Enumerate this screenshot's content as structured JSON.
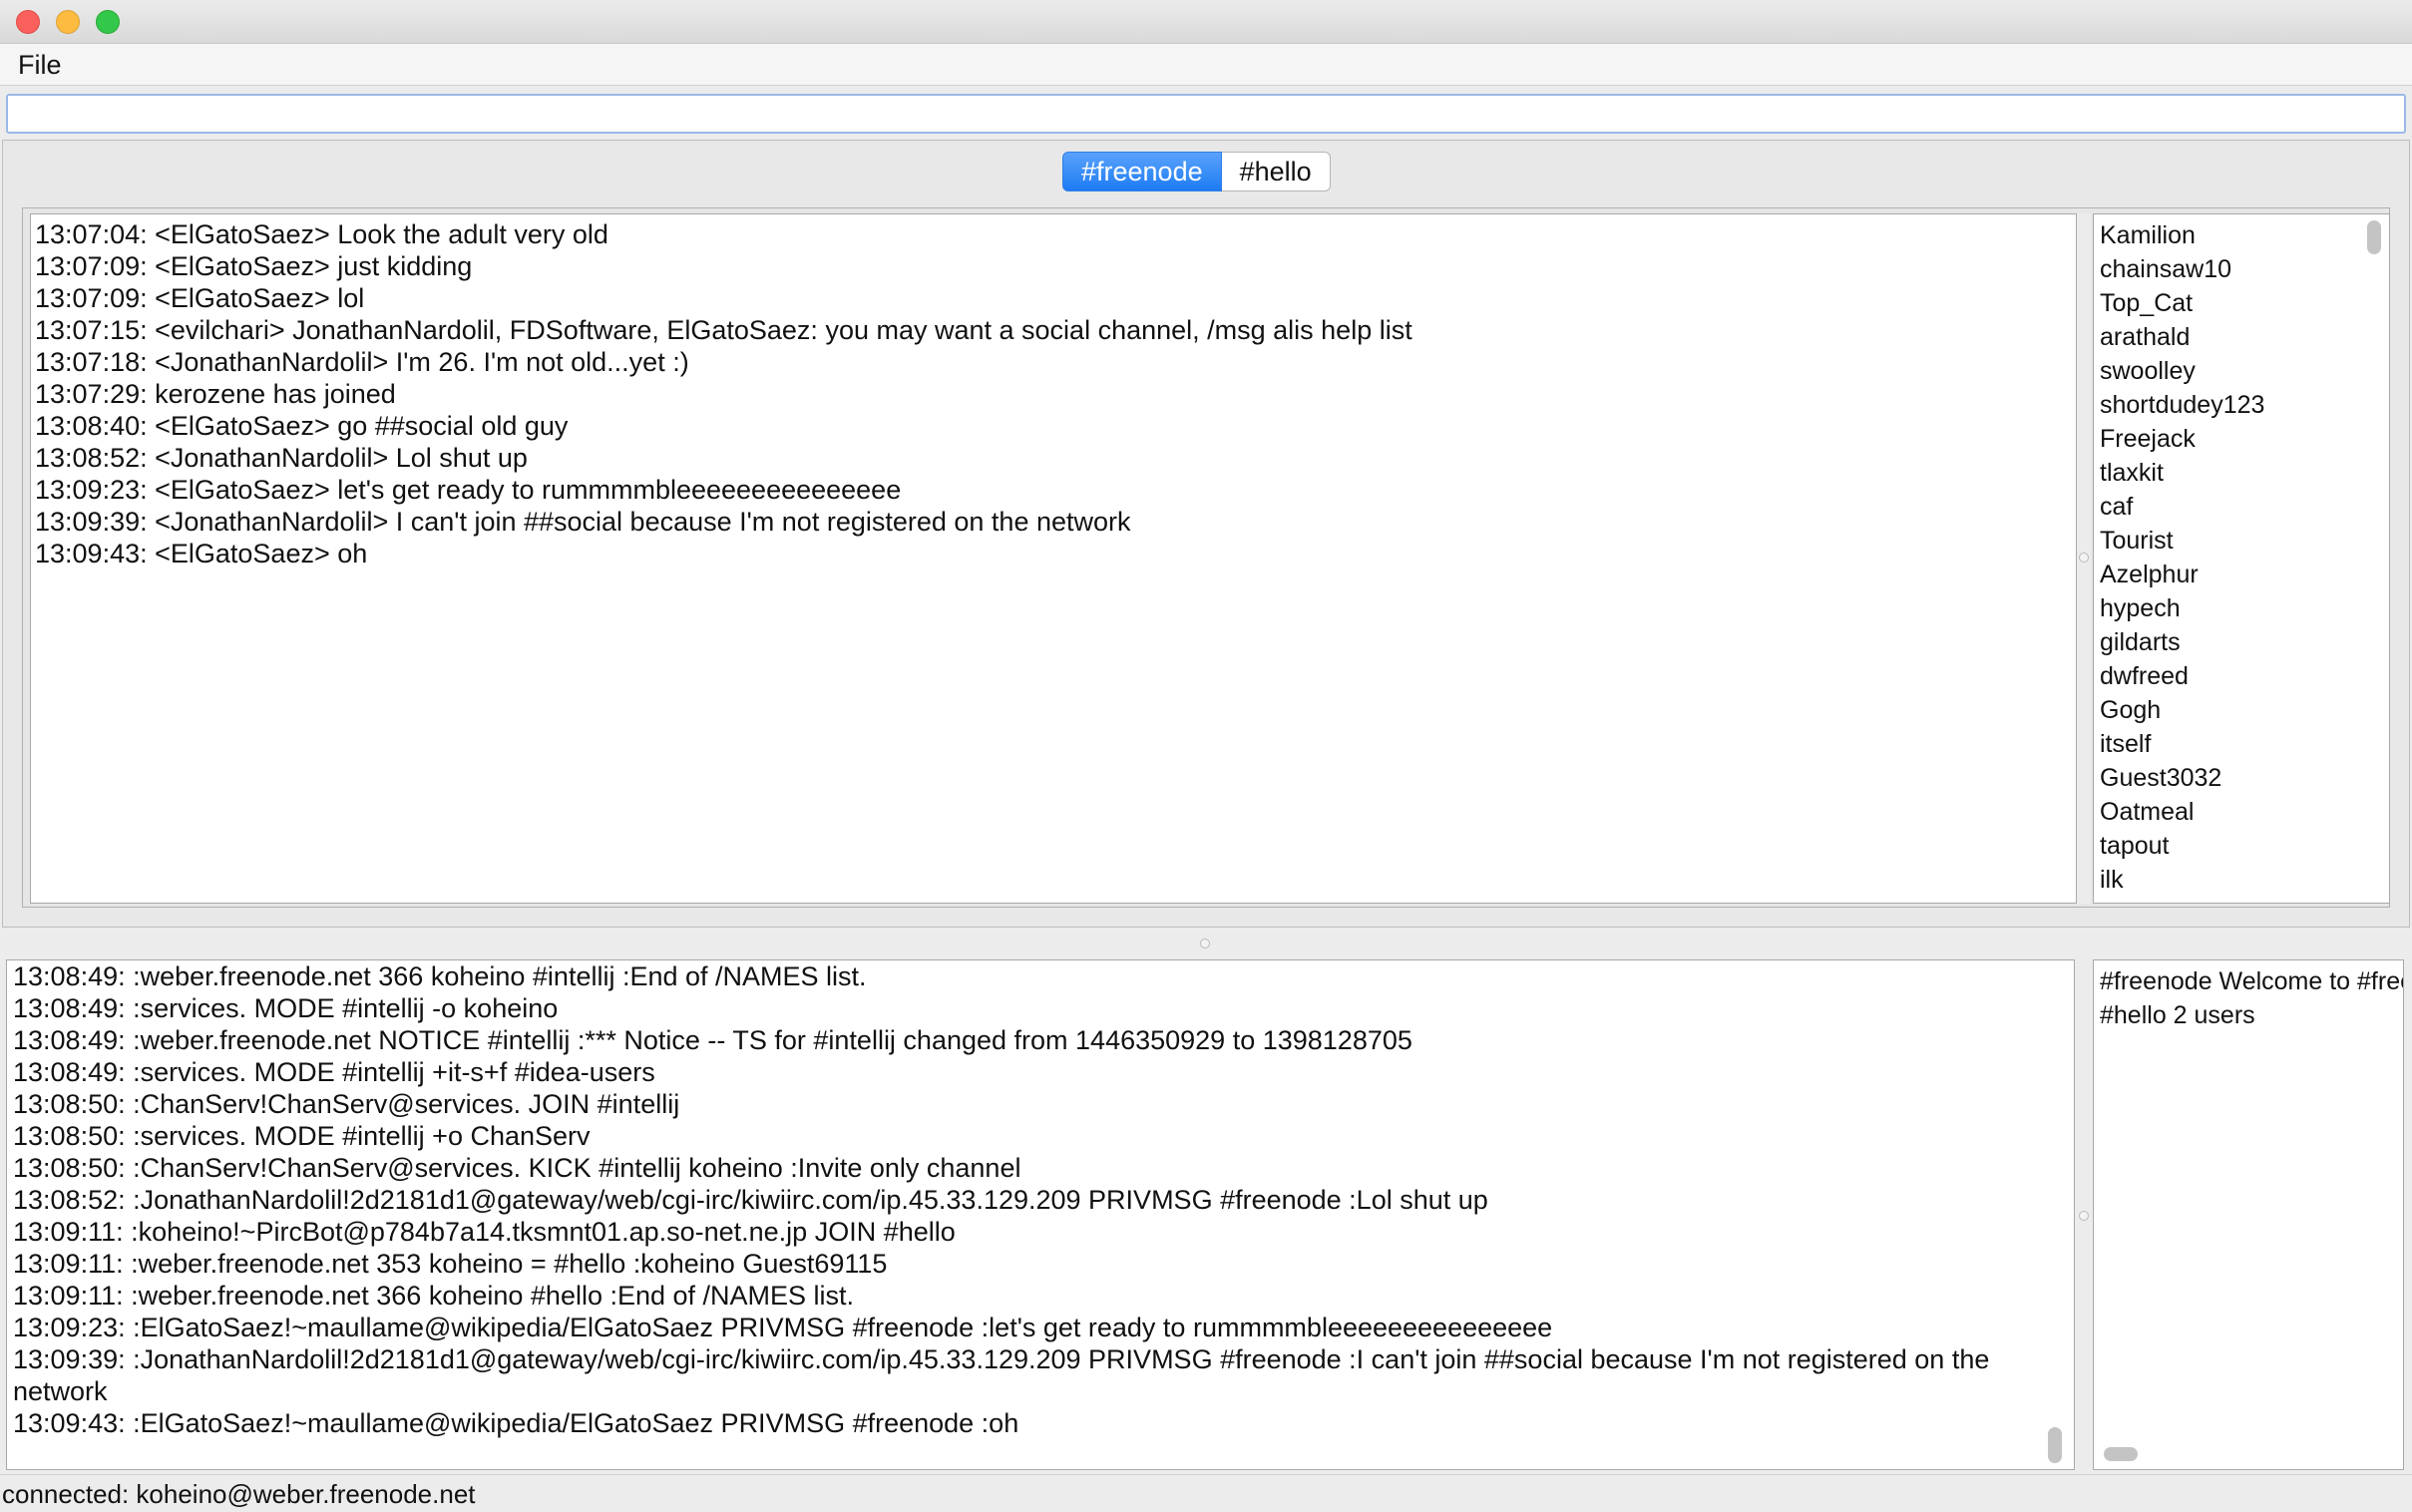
{
  "menu": {
    "file_label": "File"
  },
  "command_input": {
    "value": "",
    "placeholder": ""
  },
  "tabs": [
    {
      "label": "#freenode",
      "active": true
    },
    {
      "label": "#hello",
      "active": false
    }
  ],
  "chat": [
    "13:07:04: <ElGatoSaez> Look the adult very old",
    "13:07:09: <ElGatoSaez> just kidding",
    "13:07:09: <ElGatoSaez> lol",
    "13:07:15: <evilchari> JonathanNardolil, FDSoftware, ElGatoSaez: you may want a social channel, /msg alis help list",
    "13:07:18: <JonathanNardolil> I'm 26. I'm not old...yet :)",
    "13:07:29: kerozene has joined",
    "13:08:40: <ElGatoSaez> go ##social old guy",
    "13:08:52: <JonathanNardolil> Lol shut up",
    "13:09:23: <ElGatoSaez> let's get ready to rummmmbleeeeeeeeeeeeeee",
    "13:09:39: <JonathanNardolil> I can't join ##social because I'm not registered on the network",
    "13:09:43: <ElGatoSaez> oh"
  ],
  "users": [
    "Kamilion",
    "chainsaw10",
    "Top_Cat",
    "arathald",
    "swoolley",
    "shortdudey123",
    "Freejack",
    "tlaxkit",
    "caf",
    "Tourist",
    "Azelphur",
    "hypech",
    "gildarts",
    "dwfreed",
    "Gogh",
    "itself",
    "Guest3032",
    "Oatmeal",
    "tapout",
    "ilk"
  ],
  "log": [
    "13:08:49: :weber.freenode.net 366 koheino #intellij :End of /NAMES list.",
    "13:08:49: :services. MODE #intellij -o koheino",
    "13:08:49: :weber.freenode.net NOTICE #intellij :*** Notice -- TS for #intellij changed from 1446350929 to 1398128705",
    "13:08:49: :services. MODE #intellij +it-s+f #idea-users",
    "13:08:50: :ChanServ!ChanServ@services. JOIN #intellij",
    "13:08:50: :services. MODE #intellij +o ChanServ",
    "13:08:50: :ChanServ!ChanServ@services. KICK #intellij koheino :Invite only channel",
    "13:08:52: :JonathanNardolil!2d2181d1@gateway/web/cgi-irc/kiwiirc.com/ip.45.33.129.209 PRIVMSG #freenode :Lol shut up",
    "13:09:11: :koheino!~PircBot@p784b7a14.tksmnt01.ap.so-net.ne.jp JOIN #hello",
    "13:09:11: :weber.freenode.net 353 koheino = #hello :koheino Guest69115",
    "13:09:11: :weber.freenode.net 366 koheino #hello :End of /NAMES list.",
    "13:09:23: :ElGatoSaez!~maullame@wikipedia/ElGatoSaez PRIVMSG #freenode :let's get ready to rummmmbleeeeeeeeeeeeeee",
    "13:09:39: :JonathanNardolil!2d2181d1@gateway/web/cgi-irc/kiwiirc.com/ip.45.33.129.209 PRIVMSG #freenode :I can't join ##social because I'm not registered on the network",
    "13:09:43: :ElGatoSaez!~maullame@wikipedia/ElGatoSaez PRIVMSG #freenode :oh"
  ],
  "channel_list": [
    "#freenode Welcome to #freenode",
    "#hello  2 users"
  ],
  "status": {
    "text": "connected: koheino@weber.freenode.net"
  }
}
